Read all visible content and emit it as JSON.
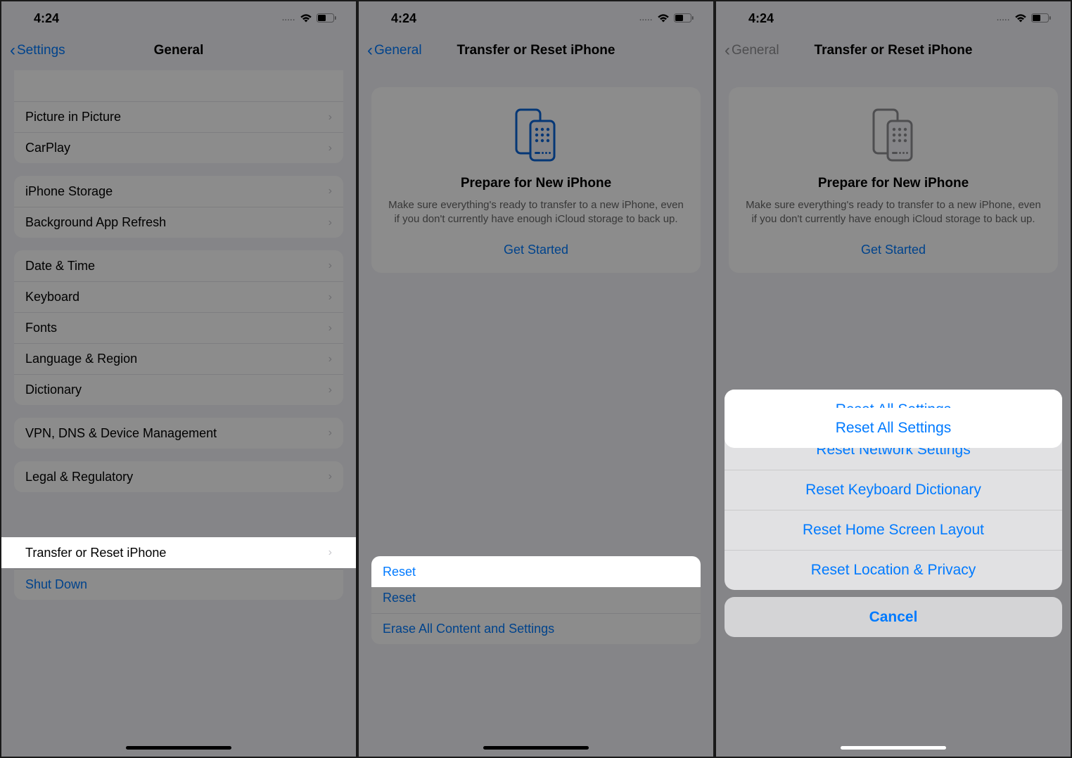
{
  "status": {
    "time": "4:24",
    "dots": "....."
  },
  "phone1": {
    "back": "Settings",
    "title": "General",
    "group1": [
      "Picture in Picture",
      "CarPlay"
    ],
    "group2": [
      "iPhone Storage",
      "Background App Refresh"
    ],
    "group3": [
      "Date & Time",
      "Keyboard",
      "Fonts",
      "Language & Region",
      "Dictionary"
    ],
    "group4": [
      "VPN, DNS & Device Management"
    ],
    "group5": [
      "Legal & Regulatory"
    ],
    "group6": [
      "Transfer or Reset iPhone",
      "Shut Down"
    ]
  },
  "phone2": {
    "back": "General",
    "title": "Transfer or Reset iPhone",
    "card": {
      "heading": "Prepare for New iPhone",
      "body": "Make sure everything's ready to transfer to a new iPhone, even if you don't currently have enough iCloud storage to back up.",
      "cta": "Get Started"
    },
    "bottom": [
      "Reset",
      "Erase All Content and Settings"
    ]
  },
  "phone3": {
    "back": "General",
    "title": "Transfer or Reset iPhone",
    "card": {
      "heading": "Prepare for New iPhone",
      "body": "Make sure everything's ready to transfer to a new iPhone, even if you don't currently have enough iCloud storage to back up.",
      "cta": "Get Started"
    },
    "sheet": [
      "Reset All Settings",
      "Reset Network Settings",
      "Reset Keyboard Dictionary",
      "Reset Home Screen Layout",
      "Reset Location & Privacy"
    ],
    "cancel": "Cancel"
  }
}
